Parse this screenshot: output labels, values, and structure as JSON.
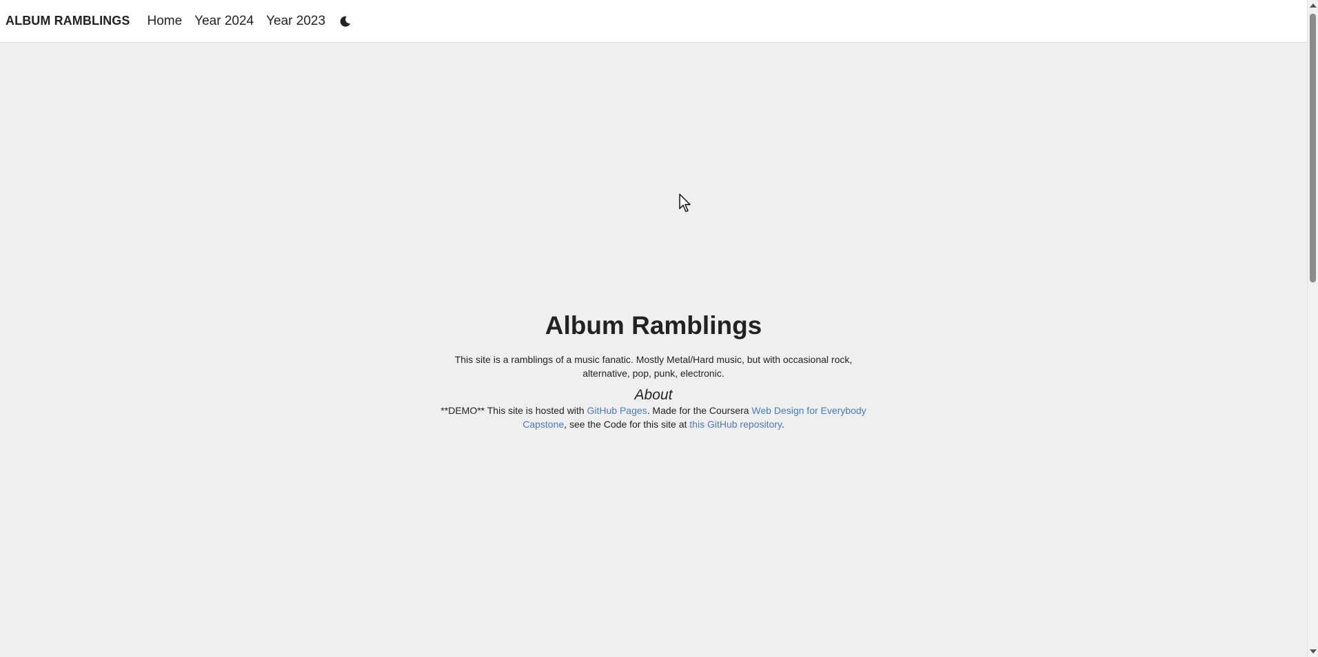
{
  "navbar": {
    "brand": "ALBUM RAMBLINGS",
    "links": [
      {
        "label": "Home"
      },
      {
        "label": "Year 2024"
      },
      {
        "label": "Year 2023"
      }
    ],
    "theme_toggle_icon": "moon-icon"
  },
  "hero": {
    "title": "Album Ramblings",
    "intro": "This site is a ramblings of a music fanatic. Mostly Metal/Hard music, but with occasional rock, alternative, pop, punk, electronic.",
    "about_title": "About",
    "about": {
      "part1": "**DEMO** This site is hosted with ",
      "link1": "GitHub Pages",
      "part2": ". Made for the Coursera ",
      "link2": "Web Design for Everybody Capstone",
      "part3": ", see the Code for this site at ",
      "link3": "this GitHub repository",
      "part4": "."
    }
  },
  "colors": {
    "background": "#efefef",
    "navbar": "#ffffff",
    "link": "#4a7ab5",
    "text": "#222222"
  }
}
